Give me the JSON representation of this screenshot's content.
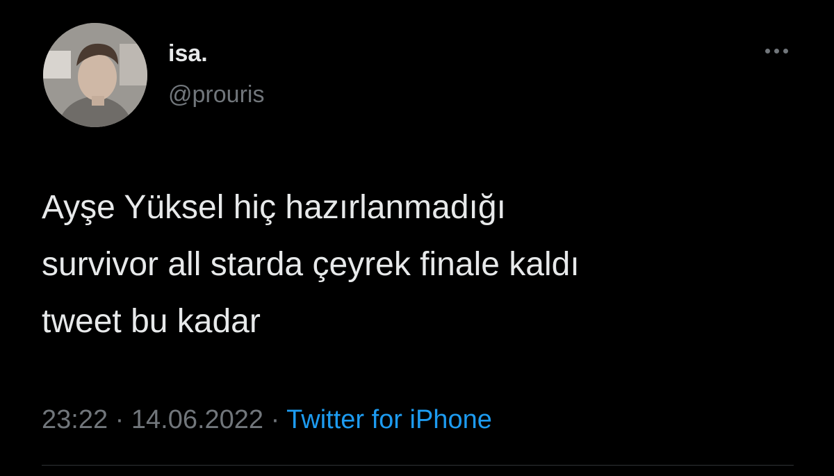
{
  "tweet": {
    "display_name": "isa.",
    "handle": "@prouris",
    "text_lines": [
      "Ayşe Yüksel hiç hazırlanmadığı",
      "survivor all starda çeyrek finale kaldı",
      "tweet bu kadar"
    ],
    "time": "23:22",
    "separator": "·",
    "date": "14.06.2022",
    "source": "Twitter for iPhone"
  },
  "icons": {
    "more": "more-options-icon"
  },
  "colors": {
    "background": "#000000",
    "text": "#e7e9ea",
    "secondary": "#71767b",
    "link": "#1d9bf0",
    "divider": "#2f3336"
  }
}
